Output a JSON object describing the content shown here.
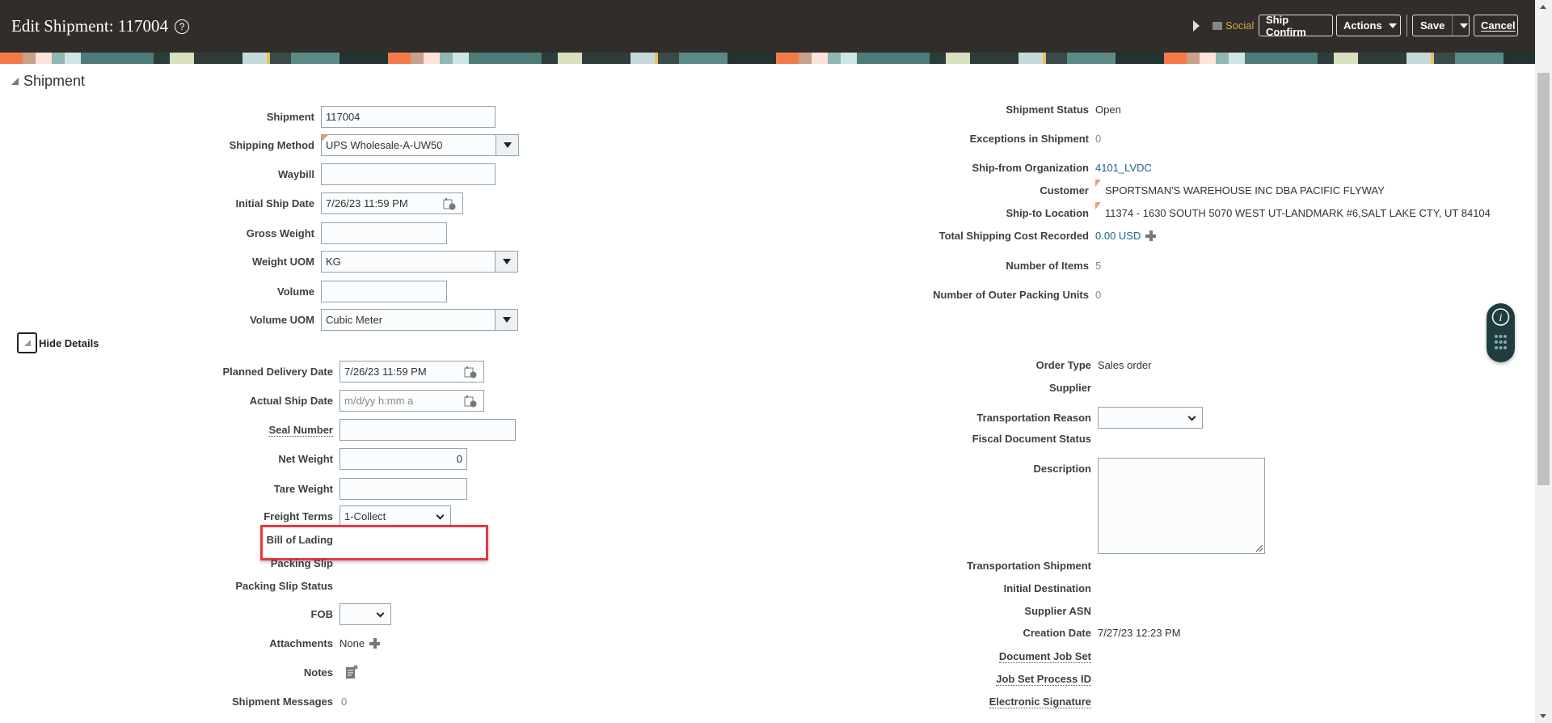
{
  "header": {
    "title": "Edit Shipment: 117004",
    "help": "?",
    "social": "Social",
    "ship_confirm": "Ship Confirm",
    "actions": "Actions",
    "save": "Save",
    "cancel": "Cancel"
  },
  "section": {
    "title": "Shipment",
    "hide_details": "Hide Details"
  },
  "left_top": {
    "shipment": {
      "label": "Shipment",
      "value": "117004"
    },
    "shipping_method": {
      "label": "Shipping Method",
      "value": "UPS Wholesale-A-UW50"
    },
    "waybill": {
      "label": "Waybill",
      "value": ""
    },
    "initial_ship_date": {
      "label": "Initial Ship Date",
      "value": "7/26/23 11:59 PM"
    },
    "gross_weight": {
      "label": "Gross Weight",
      "value": ""
    },
    "weight_uom": {
      "label": "Weight UOM",
      "value": "KG"
    },
    "volume": {
      "label": "Volume",
      "value": ""
    },
    "volume_uom": {
      "label": "Volume UOM",
      "value": "Cubic Meter"
    }
  },
  "left_details": {
    "planned_delivery_date": {
      "label": "Planned Delivery Date",
      "value": "7/26/23 11:59 PM"
    },
    "actual_ship_date": {
      "label": "Actual Ship Date",
      "placeholder": "m/d/yy h:mm a"
    },
    "seal_number": {
      "label": "Seal Number",
      "value": ""
    },
    "net_weight": {
      "label": "Net Weight",
      "value": "0"
    },
    "tare_weight": {
      "label": "Tare Weight",
      "value": ""
    },
    "freight_terms": {
      "label": "Freight Terms",
      "value": "1-Collect"
    },
    "bill_of_lading": {
      "label": "Bill of Lading"
    },
    "packing_slip": {
      "label": "Packing Slip"
    },
    "packing_slip_status": {
      "label": "Packing Slip Status"
    },
    "fob": {
      "label": "FOB",
      "value": ""
    },
    "attachments": {
      "label": "Attachments",
      "value": "None"
    },
    "notes": {
      "label": "Notes"
    },
    "shipment_messages": {
      "label": "Shipment Messages",
      "value": "0"
    }
  },
  "right_top": {
    "shipment_status": {
      "label": "Shipment Status",
      "value": "Open"
    },
    "exceptions": {
      "label": "Exceptions in Shipment",
      "value": "0"
    },
    "ship_from": {
      "label": "Ship-from Organization",
      "value": "4101_LVDC"
    },
    "customer": {
      "label": "Customer",
      "value": "SPORTSMAN'S WAREHOUSE INC DBA PACIFIC FLYWAY"
    },
    "ship_to": {
      "label": "Ship-to Location",
      "value": "11374 - 1630 SOUTH 5070 WEST UT-LANDMARK #6,SALT LAKE CTY, UT 84104"
    },
    "total_cost": {
      "label": "Total Shipping Cost Recorded",
      "value": "0.00 USD"
    },
    "num_items": {
      "label": "Number of Items",
      "value": "5"
    },
    "outer_units": {
      "label": "Number of Outer Packing Units",
      "value": "0"
    }
  },
  "right_details": {
    "order_type": {
      "label": "Order Type",
      "value": "Sales order"
    },
    "supplier": {
      "label": "Supplier"
    },
    "transportation_reason": {
      "label": "Transportation Reason",
      "value": ""
    },
    "fiscal_status": {
      "label": "Fiscal Document Status"
    },
    "description": {
      "label": "Description",
      "value": ""
    },
    "transportation_shipment": {
      "label": "Transportation Shipment"
    },
    "initial_destination": {
      "label": "Initial Destination"
    },
    "supplier_asn": {
      "label": "Supplier ASN"
    },
    "creation_date": {
      "label": "Creation Date",
      "value": "7/27/23 12:23 PM"
    },
    "document_job_set": {
      "label": "Document Job Set"
    },
    "job_set_process_id": {
      "label": "Job Set Process ID"
    },
    "electronic_signature": {
      "label": "Electronic Signature"
    }
  },
  "colors": {
    "header_bg": "#312d2a",
    "accent": "#1a6785",
    "highlight": "#e8383f",
    "social": "#d4a94a"
  }
}
